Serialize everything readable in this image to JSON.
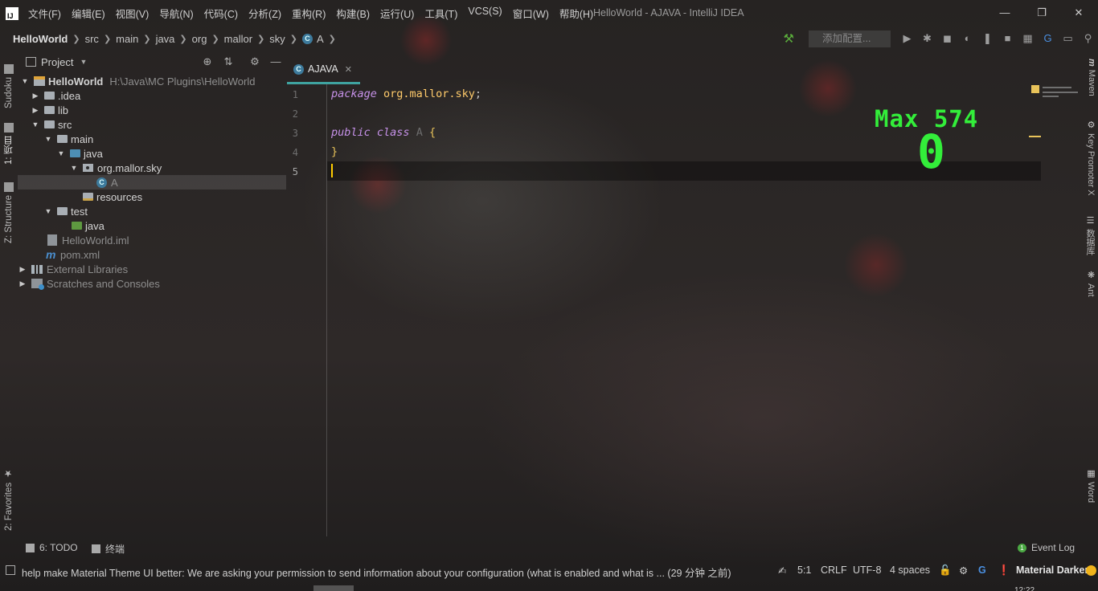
{
  "window": {
    "logo_text": "IJ",
    "title": "HelloWorld - AJAVA - IntelliJ IDEA"
  },
  "menu": [
    "文件(F)",
    "编辑(E)",
    "视图(V)",
    "导航(N)",
    "代码(C)",
    "分析(Z)",
    "重构(R)",
    "构建(B)",
    "运行(U)",
    "工具(T)",
    "VCS(S)",
    "窗口(W)",
    "帮助(H)"
  ],
  "breadcrumb": [
    "HelloWorld",
    "src",
    "main",
    "java",
    "org",
    "mallor",
    "sky",
    "A"
  ],
  "toolbar": {
    "add_config": "添加配置..."
  },
  "left_stripe": {
    "sudoku": "Sudoku",
    "project": "1: 项目",
    "structure": "Z: Structure",
    "favorites": "2: Favorites"
  },
  "project_panel": {
    "title": "Project",
    "tree": [
      {
        "label": "HelloWorld",
        "path": "H:\\Java\\MC Plugins\\HelloWorld"
      },
      {
        "label": ".idea"
      },
      {
        "label": "lib"
      },
      {
        "label": "src"
      },
      {
        "label": "main"
      },
      {
        "label": "java"
      },
      {
        "label": "org.mallor.sky"
      },
      {
        "label": "A"
      },
      {
        "label": "resources"
      },
      {
        "label": "test"
      },
      {
        "label": "java"
      },
      {
        "label": "HelloWorld.iml"
      },
      {
        "label": "pom.xml"
      },
      {
        "label": "External Libraries"
      },
      {
        "label": "Scratches and Consoles"
      }
    ]
  },
  "editor": {
    "tab_label": "AJAVA",
    "class_icon_letter": "C",
    "line_numbers": [
      "1",
      "2",
      "3",
      "4",
      "5"
    ],
    "code": {
      "line1_kw": "package",
      "line1_pkg": "org.mallor.sky",
      "line1_end": ";",
      "line3_kw1": "public",
      "line3_kw2": "class",
      "line3_name": "A",
      "line3_brace": "{",
      "line4_brace": "}"
    },
    "power_mode": {
      "max_label": "Max 574",
      "count": "0"
    }
  },
  "right_stripe": {
    "maven": "Maven",
    "key_promoter": "Key Promoter X",
    "database": "数据库",
    "ant": "Ant",
    "word": "Word"
  },
  "bottom_tools": {
    "todo": "6: TODO",
    "terminal": "终端",
    "event_log": "Event Log"
  },
  "status": {
    "message": "help make Material Theme UI better: We are asking your permission to send information about your configuration (what is enabled and what is ... (29 分钟 之前)",
    "position": "5:1",
    "line_sep": "CRLF",
    "encoding": "UTF-8",
    "indent": "4 spaces",
    "theme": "Material Darker",
    "clock": "12:22"
  },
  "colors": {
    "accent_tab": "#3fa3a0",
    "power_mode": "#33ee3a",
    "theme_dot": "#f0b31b"
  }
}
